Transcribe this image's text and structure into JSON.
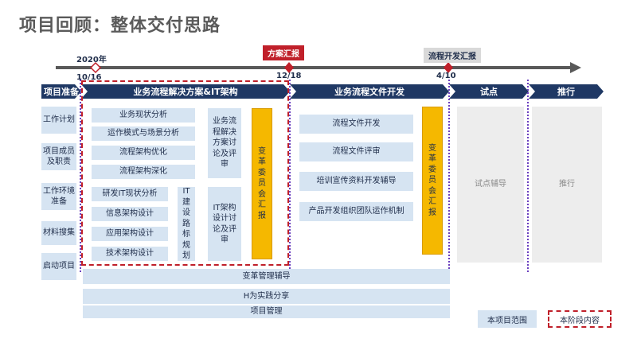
{
  "title": "项目回顾：整体交付思路",
  "timeline": {
    "year_label": "2020年",
    "date_start": "10/16",
    "date_mid": "12/18",
    "date_end": "4/10",
    "callout_plan": "方案汇报",
    "callout_process": "流程开发汇报"
  },
  "phases": {
    "prep": "项目准备",
    "solution": "业务流程解决方案&IT架构",
    "docs": "业务流程文件开发",
    "pilot": "试点",
    "rollout": "推行"
  },
  "prep_items": [
    "工作计划",
    "项目成员及职责",
    "工作环境准备",
    "材料搜集",
    "启动项目"
  ],
  "solution_items": [
    "业务现状分析",
    "运作模式与场景分析",
    "流程架构优化",
    "流程架构深化"
  ],
  "it_items": [
    "研发IT现状分析",
    "信息架构设计",
    "应用架构设计",
    "技术架构设计"
  ],
  "it_planning": "IT建设路标规划",
  "discuss_process": "业务流程解决方案讨论及评审",
  "discuss_it": "IT架构设计讨论及评审",
  "committee_report_1": "变革委员会汇报",
  "doc_items": [
    "流程文件开发",
    "流程文件评审",
    "培训宣传资料开发辅导",
    "产品开发组织团队运作机制"
  ],
  "committee_report_2": "变革委员会汇报",
  "pilot_box": "试点辅导",
  "rollout_box": "推行",
  "bars": [
    "变革管理辅导",
    "H为实践分享",
    "项目管理"
  ],
  "legend": {
    "scope": "本项目范围",
    "stage": "本阶段内容"
  },
  "colors": {
    "phase_bar": "#1f3864",
    "box": "#d6e4f2",
    "highlight": "#f5b800",
    "accent_red": "#c0202a",
    "divider": "#6a3fbf"
  }
}
